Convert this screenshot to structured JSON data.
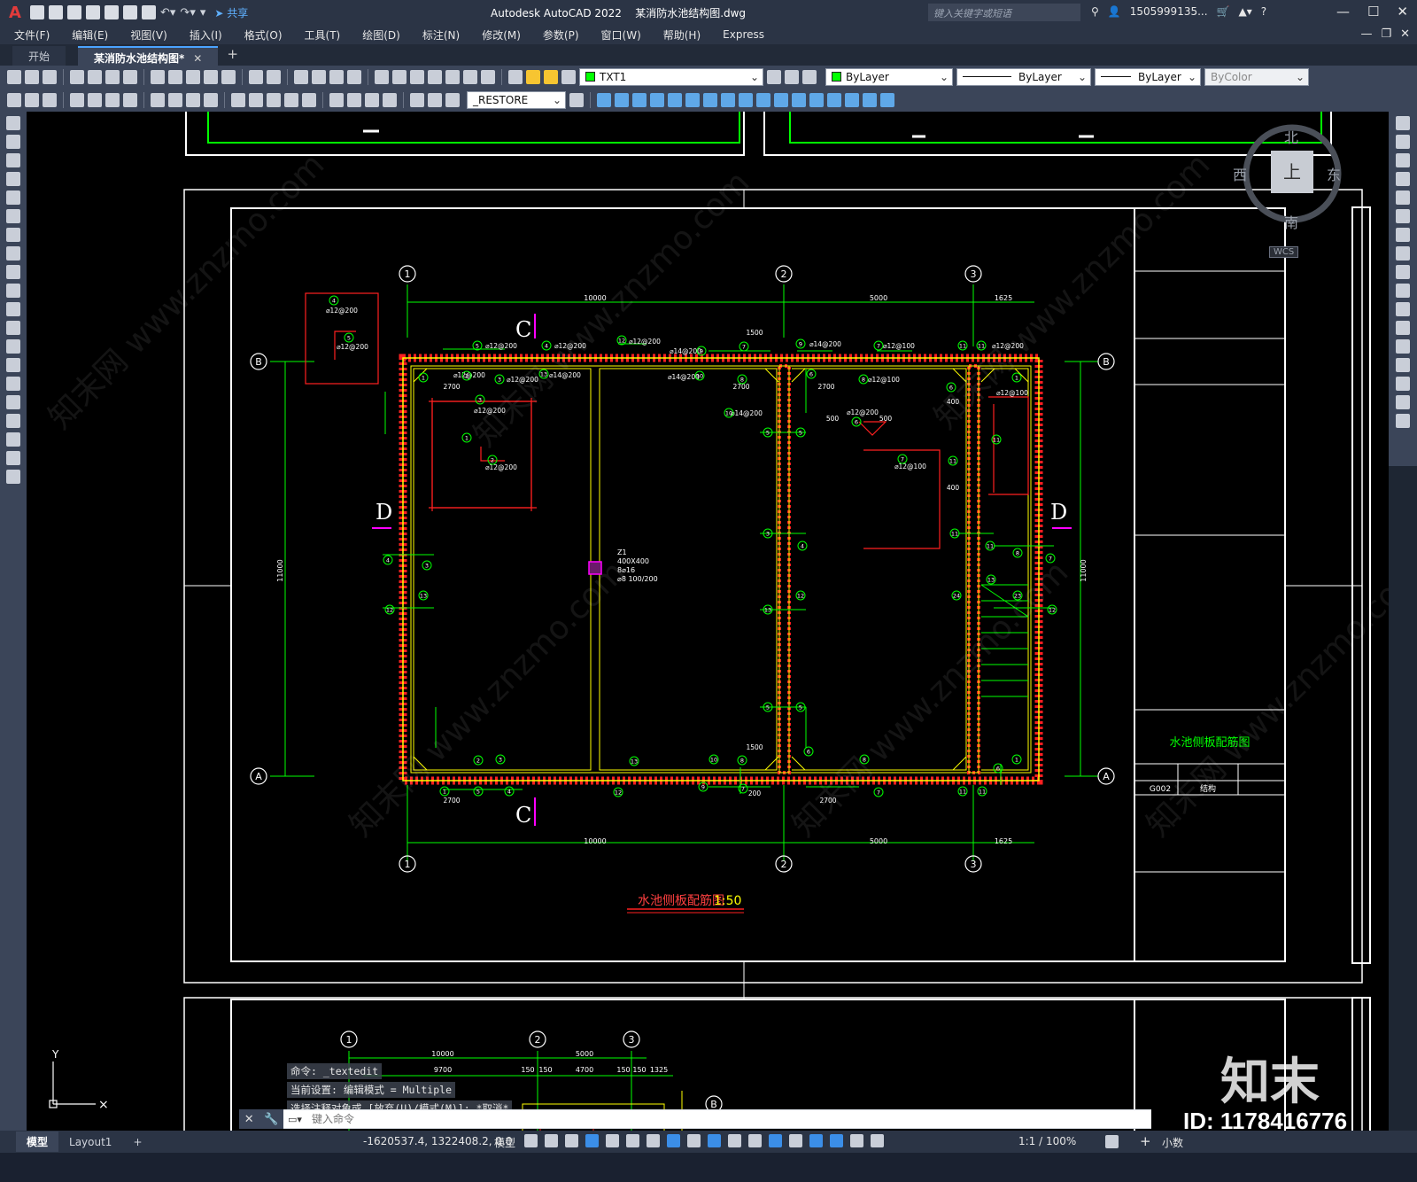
{
  "app": {
    "title": "Autodesk AutoCAD 2022",
    "filename": "某消防水池结构图.dwg",
    "share_label": "共享",
    "search_placeholder": "键入关键字或短语",
    "user": "1505999135...",
    "help": "?"
  },
  "menu": [
    "文件(F)",
    "编辑(E)",
    "视图(V)",
    "插入(I)",
    "格式(O)",
    "工具(T)",
    "绘图(D)",
    "标注(N)",
    "修改(M)",
    "参数(P)",
    "窗口(W)",
    "帮助(H)",
    "Express"
  ],
  "tabs": [
    {
      "label": "开始"
    },
    {
      "label": "某消防水池结构图*"
    }
  ],
  "toolbar": {
    "text_style": "TXT1",
    "layer_color": "ByLayer",
    "linetype": "ByLayer",
    "lineweight": "ByLayer",
    "plotstyle": "ByColor",
    "restore": "_RESTORE"
  },
  "viewcube": {
    "north": "北",
    "south": "南",
    "east": "东",
    "west": "西",
    "top": "上",
    "wcs": "WCS"
  },
  "drawing": {
    "title": "水池侧板配筋图",
    "scale": "1:50",
    "titleblock_drawing_name": "水池侧板配筋图",
    "titleblock_code": "G002",
    "titleblock_phase": "结构",
    "axis_labels": [
      "1",
      "2",
      "3",
      "A",
      "B"
    ],
    "section_labels": [
      "C",
      "D"
    ],
    "dims_top": [
      "10000",
      "5000",
      "1625"
    ],
    "dims_bottom": [
      "10000",
      "5000",
      "1625"
    ],
    "dim_vertical": "11000",
    "column_note": [
      "Z1",
      "400X400",
      "8⌀16",
      "⌀8 100/200"
    ],
    "lower_dims_a": [
      "10000",
      "5000"
    ],
    "lower_dims_b": [
      "9700",
      "150",
      "150",
      "4700",
      "150",
      "150",
      "1325"
    ],
    "rebar_labels": [
      "⌀12@200",
      "⌀14@200",
      "⌀12@100",
      "⌀14@200",
      "⌀12@200",
      "⌀12@100"
    ],
    "small_dims": [
      "2700",
      "2700",
      "2700",
      "1500",
      "1500",
      "500",
      "500",
      "400",
      "400",
      "200",
      "2700",
      "2700"
    ]
  },
  "command": {
    "history": [
      "命令: _textedit",
      "当前设置: 编辑模式 = Multiple",
      "选择注释对象或 [放弃(U)/模式(M)]: *取消*"
    ],
    "placeholder": "键入命令"
  },
  "status": {
    "model_tab": "模型",
    "layout_tab": "Layout1",
    "coords": "-1620537.4, 1322408.2, 0.0",
    "space": "模型",
    "scale": "1:1 / 100%",
    "units": "小数"
  },
  "watermark": {
    "brand": "知末",
    "id": "ID: 1178416776",
    "site": "知末网 www.znzmo.com"
  },
  "colors": {
    "green": "#00ff00",
    "yellow": "#ffff00",
    "red": "#ff2020",
    "magenta": "#ff00ff",
    "white": "#ffffff",
    "canvas": "#000000",
    "panel": "#3b4559"
  }
}
